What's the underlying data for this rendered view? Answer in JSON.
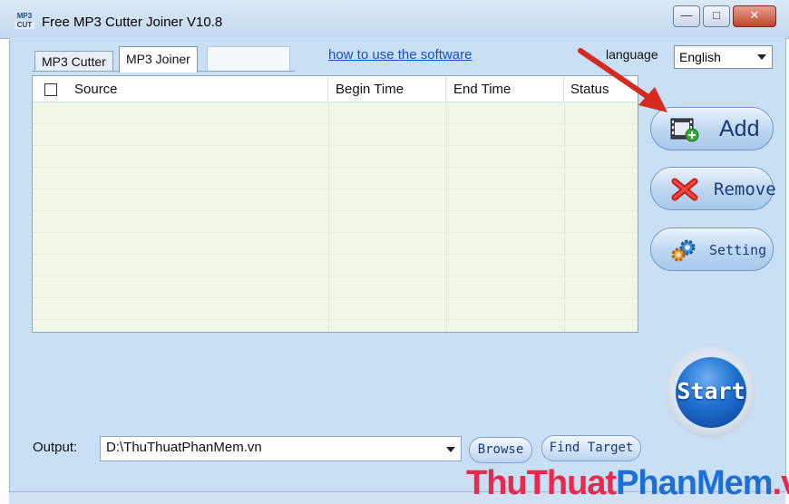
{
  "window": {
    "icon_text_top": "MP3",
    "icon_text_bottom": "CUT",
    "title": "Free MP3 Cutter Joiner V10.8"
  },
  "tabs": [
    {
      "label": "MP3 Cutter",
      "active": false
    },
    {
      "label": "MP3 Joiner",
      "active": true
    }
  ],
  "help_link": "how to use the software",
  "language": {
    "label": "language",
    "selected": "English"
  },
  "table": {
    "columns": [
      "Source",
      "Begin Time",
      "End Time",
      "Status"
    ],
    "rows": []
  },
  "buttons": {
    "add": "Add",
    "remove": "Remove",
    "setting": "Setting",
    "start": "Start",
    "browse": "Browse",
    "find_target": "Find Target"
  },
  "output": {
    "label": "Output:",
    "value": "D:\\ThuThuatPhanMem.vn"
  },
  "watermark": {
    "part1": "Thu",
    "part2": "Thuat",
    "part3": "PhanMem",
    "part4": ".vn"
  },
  "colors": {
    "arrow": "#d42a1f",
    "start": "#1f6fd0",
    "link": "#1a4fc4"
  }
}
